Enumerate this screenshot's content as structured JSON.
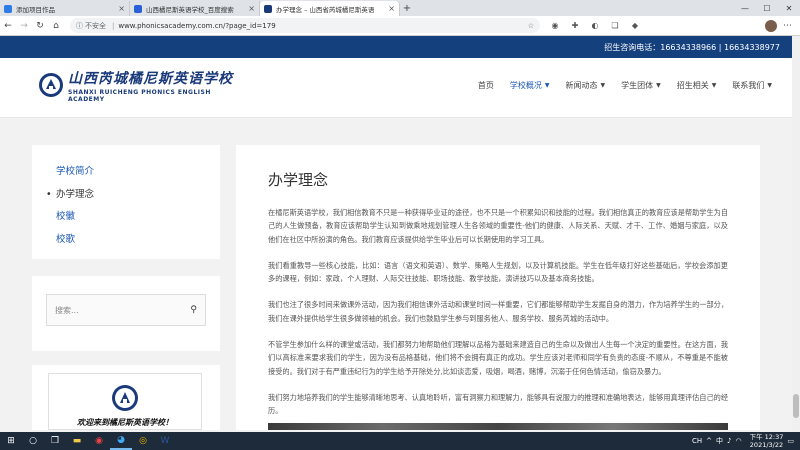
{
  "browser": {
    "tabs": [
      {
        "title": "添加项目作品",
        "favicon_color": "#2d7be5",
        "active": false
      },
      {
        "title": "山西橘尼斯英语学校_百度搜索",
        "favicon_color": "#2b5fd9",
        "active": false
      },
      {
        "title": "办学理念 – 山西省芮城橘尼斯英语",
        "favicon_color": "#1a3a7a",
        "active": true
      }
    ],
    "new_tab_label": "+",
    "security_label": "不安全",
    "url": "www.phonicsacademy.com.cn/?page_id=179"
  },
  "site": {
    "contact_bar": "招生咨询电话：16634338966 | 16634338977",
    "logo": {
      "cn": "山西芮城橘尼斯英语学校",
      "en": "SHANXI RUICHENG PHONICS ENGLISH ACADEMY"
    },
    "nav": [
      {
        "label": "首页",
        "dropdown": false,
        "active": false
      },
      {
        "label": "学校概况",
        "dropdown": true,
        "active": true
      },
      {
        "label": "新闻动态",
        "dropdown": true,
        "active": false
      },
      {
        "label": "学生团体",
        "dropdown": true,
        "active": false
      },
      {
        "label": "招生相关",
        "dropdown": true,
        "active": false
      },
      {
        "label": "联系我们",
        "dropdown": true,
        "active": false
      }
    ]
  },
  "sidebar": {
    "items": [
      {
        "label": "学校简介",
        "current": false
      },
      {
        "label": "办学理念",
        "current": true
      },
      {
        "label": "校徽",
        "current": false
      },
      {
        "label": "校歌",
        "current": false
      }
    ],
    "search_placeholder": "搜索...",
    "welcome_text": "欢迎来到橘尼斯英语学校！"
  },
  "article": {
    "title": "办学理念",
    "paragraphs": [
      "在橘尼斯英语学校，我们相信教育不只是一种获得毕业证的途径，也不只是一个积累知识和技能的过程。我们相信真正的教育应该是帮助学生为自己的人生做预备，教育应该帮助学生认知到做乘地规划管理人生各领域的重要性-他们的健康、人际关系、天赋、才干、工作、婚姻与家庭，以及他们在社区中所扮演的角色。我们教育应该提供给学生毕业后可以长期使用的学习工具。",
      "我们看重教导一些核心技能，比如：语言（语文和英语）、数学、策略人生规划，以及计算机技能。学生在低年级打好这些基础后，学校会添加更多的课程，例如：家政，个人理财、人际交往技能、职场技能、教学技能，演讲技巧以及基本商务技能。",
      "我们也注了很多时间来做课外活动，因为我们相信课外活动和课堂时间一样重要，它们都能够帮助学生发掘自身的潜力，作为培养学生的一部分，我们在课外提供给学生很多做领袖的机会。我们也鼓励学生参与到服务他人、服务学校、服务芮城的活动中。",
      "不管学生参加什么样的课堂或活动，我们都努力地帮助他们理解以品格为基础来建造自己的生命以及做出人生每一个决定的重要性。在这方面，我们以高标准来要求我们的学生，因为没有品格基础，他们将不会拥有真正的成功。学生应该对老师和同学有负责的态度-不顺从，不尊重是不能被接受的。我们对于有严重违纪行为的学生给予开除处分,比如谈恋爱，吸烟，喝酒，赌博，沉溺于任何色情活动，偷窃及暴力。",
      "我们努力地培养我们的学生能够清晰地思考、认真地聆听，富有洞察力和理解力，能够具有说服力的推理和准确地表达，能够用真理评估自己的经历。"
    ]
  },
  "taskbar": {
    "lang": "CH",
    "time": "下午 12:37",
    "date": "2021/3/22",
    "ime": "中"
  }
}
